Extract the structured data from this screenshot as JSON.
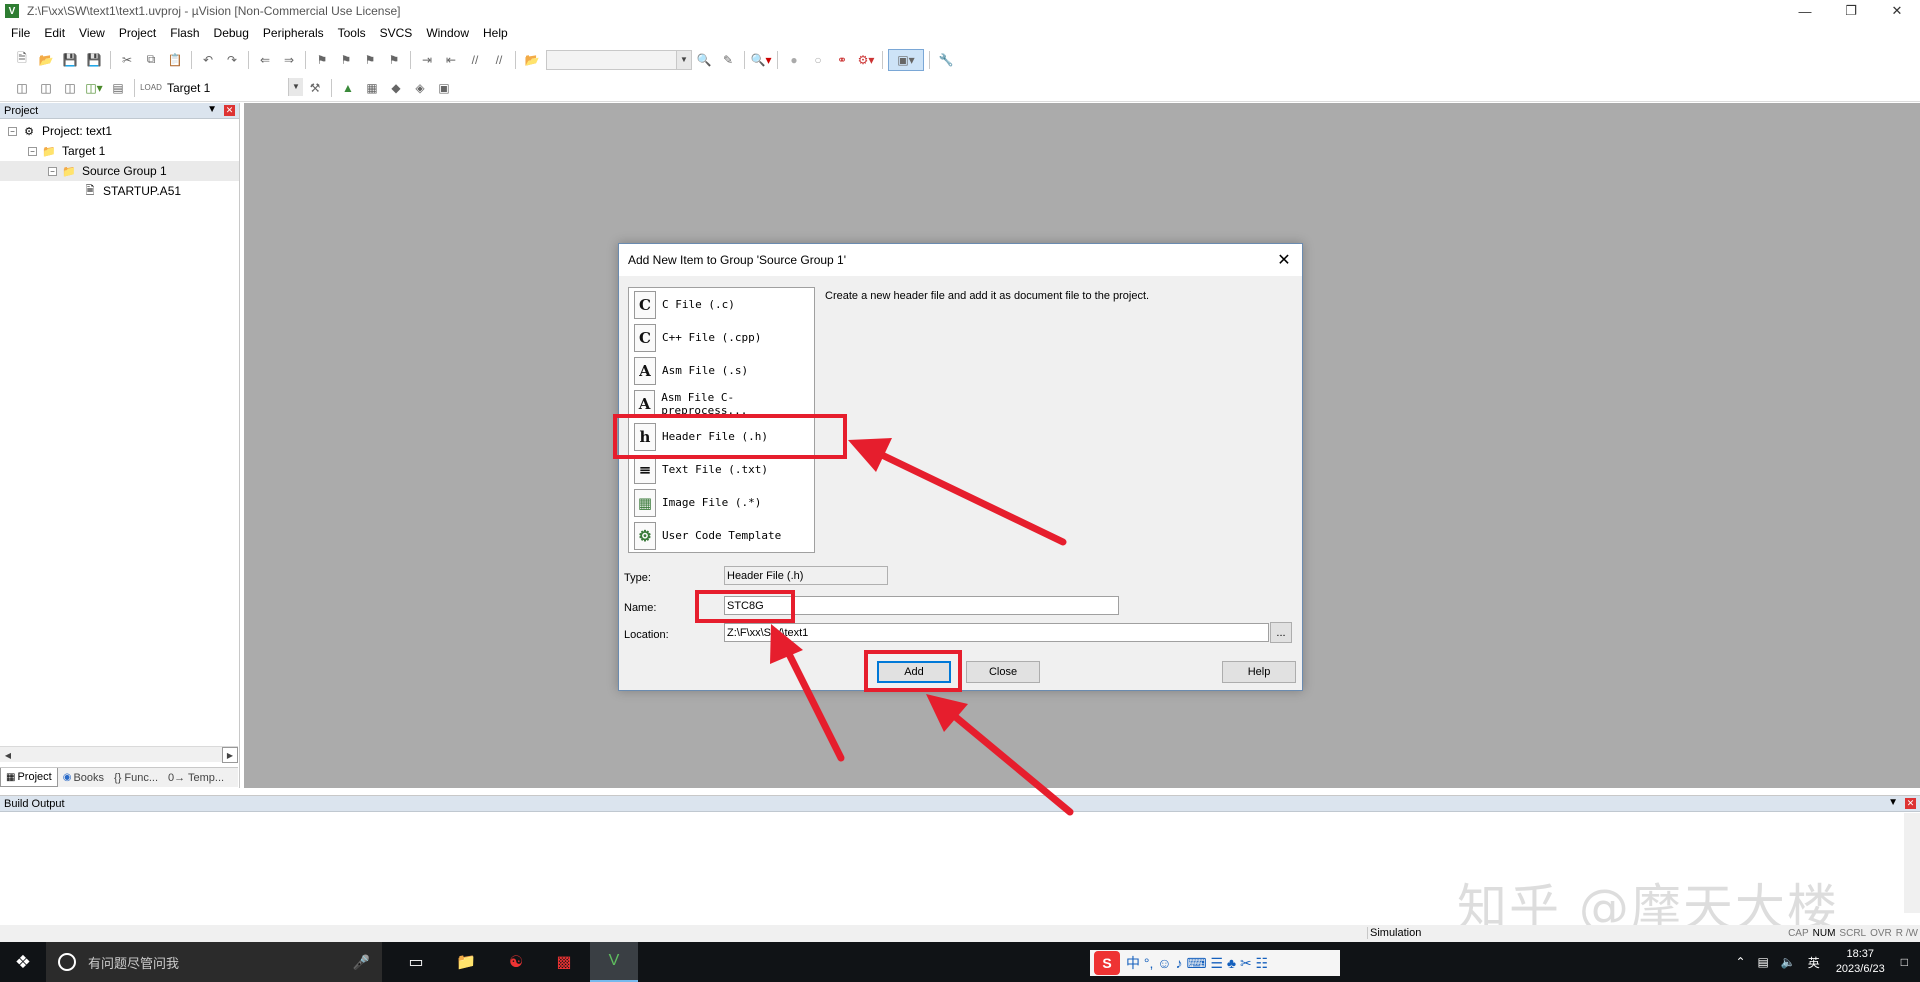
{
  "window": {
    "title": "Z:\\F\\xx\\SW\\text1\\text1.uvproj - µVision  [Non-Commercial Use License]",
    "controls": [
      "—",
      "❐",
      "✕"
    ]
  },
  "menu": [
    "File",
    "Edit",
    "View",
    "Project",
    "Flash",
    "Debug",
    "Peripherals",
    "Tools",
    "SVCS",
    "Window",
    "Help"
  ],
  "toolbar2": {
    "target": "Target 1"
  },
  "project_panel": {
    "title": "Project",
    "tree": [
      {
        "label": "Project: text1",
        "level": 0
      },
      {
        "label": "Target 1",
        "level": 1
      },
      {
        "label": "Source Group 1",
        "level": 2
      },
      {
        "label": "STARTUP.A51",
        "level": 3
      }
    ],
    "tabs": [
      "Project",
      "Books",
      "{} Func...",
      "0→ Temp..."
    ]
  },
  "dialog": {
    "title": "Add New Item to Group 'Source Group 1'",
    "file_types": [
      {
        "icon": "C",
        "label": "C File (.c)"
      },
      {
        "icon": "C",
        "label": "C++ File (.cpp)"
      },
      {
        "icon": "A",
        "label": "Asm File (.s)"
      },
      {
        "icon": "A",
        "label": "Asm File C-preprocess..."
      },
      {
        "icon": "h",
        "label": "Header File (.h)"
      },
      {
        "icon": "≡",
        "label": "Text File (.txt)"
      },
      {
        "icon": "▦",
        "label": "Image File (.*)"
      },
      {
        "icon": "⚙",
        "label": "User Code Template"
      }
    ],
    "description": "Create a new header file and add it as document file to the project.",
    "type_label": "Type:",
    "type_value": "Header File (.h)",
    "name_label": "Name:",
    "name_value": "STC8G",
    "location_label": "Location:",
    "location_value": "Z:\\F\\xx\\SW\\text1",
    "browse": "...",
    "buttons": {
      "add": "Add",
      "close": "Close",
      "help": "Help"
    }
  },
  "build_output": {
    "title": "Build Output"
  },
  "watermark": "知乎 @摩天大楼",
  "status": {
    "mode": "Simulation",
    "indicators": [
      "CAP",
      "NUM",
      "SCRL",
      "OVR",
      "R /W"
    ]
  },
  "taskbar": {
    "search_placeholder": "有问题尽管问我",
    "time": "18:37",
    "date": "2023/6/23",
    "ime_lang": "英",
    "ime_text": "中 °, ☺ ♪ ⌨ ☰ ♣ ✂ ☷"
  },
  "colors": {
    "highlight_red": "#e61e2d",
    "main_area": "#ababab",
    "focus_blue": "#0078d7"
  }
}
